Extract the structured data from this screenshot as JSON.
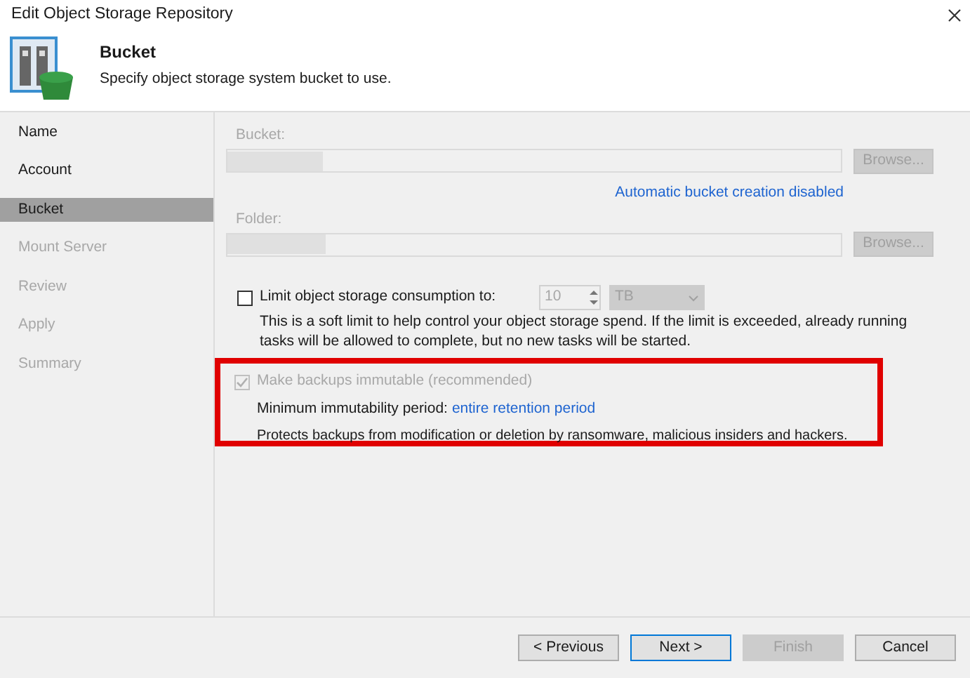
{
  "window": {
    "title": "Edit Object Storage Repository"
  },
  "header": {
    "title": "Bucket",
    "subtitle": "Specify object storage system bucket to use."
  },
  "steps": [
    {
      "label": "Name",
      "selected": false,
      "disabled": false
    },
    {
      "label": "Account",
      "selected": false,
      "disabled": false
    },
    {
      "label": "Bucket",
      "selected": true,
      "disabled": false
    },
    {
      "label": "Mount Server",
      "selected": false,
      "disabled": true
    },
    {
      "label": "Review",
      "selected": false,
      "disabled": true
    },
    {
      "label": "Apply",
      "selected": false,
      "disabled": true
    },
    {
      "label": "Summary",
      "selected": false,
      "disabled": true
    }
  ],
  "bucket": {
    "label": "Bucket:",
    "button": "Browse...",
    "link": "Automatic bucket creation disabled"
  },
  "folder": {
    "label": "Folder:",
    "button": "Browse..."
  },
  "limit": {
    "label": "Limit object storage consumption to:",
    "checked": false,
    "value": "10",
    "unit": "TB",
    "description": "This is a soft limit to help control your object storage spend. If the limit is exceeded, already running tasks will be allowed to complete, but no new tasks will be started."
  },
  "immutable": {
    "label": "Make backups immutable (recommended)",
    "checked": true,
    "disabled": true,
    "period_label": "Minimum immutability period:",
    "period_link": "entire retention period",
    "description": "Protects backups from modification or deletion by ransomware, malicious insiders and hackers."
  },
  "buttons": [
    {
      "label": "< Previous",
      "disabled": false,
      "default": false
    },
    {
      "label": "Next >",
      "disabled": false,
      "default": true
    },
    {
      "label": "Finish",
      "disabled": true,
      "default": false
    },
    {
      "label": "Cancel",
      "disabled": false,
      "default": false
    }
  ]
}
